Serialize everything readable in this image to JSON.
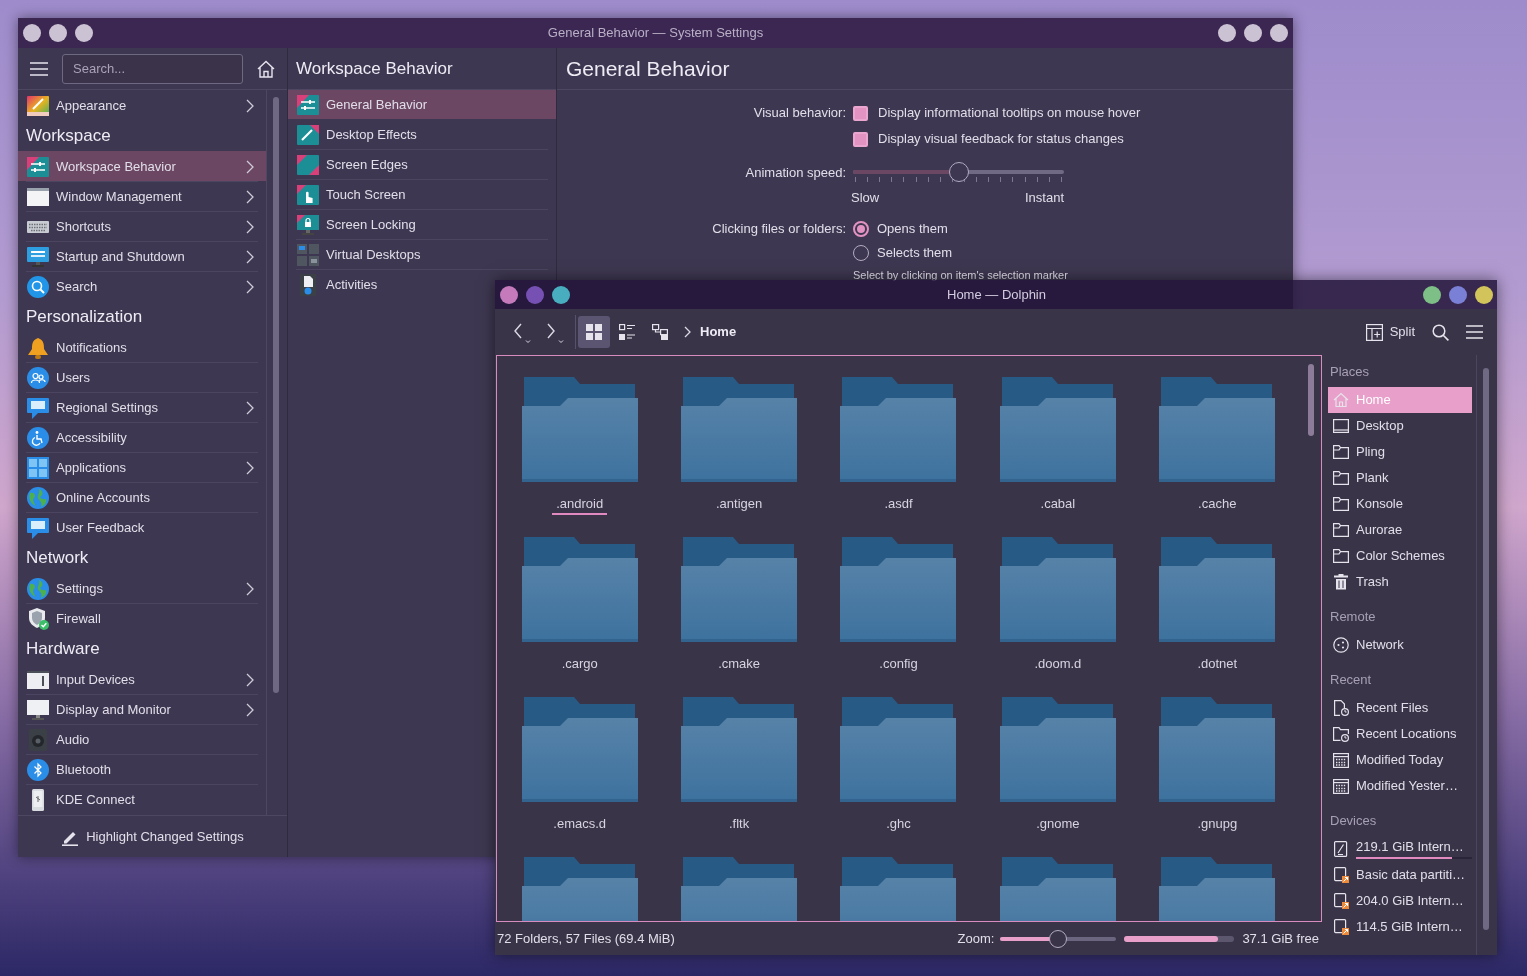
{
  "settings_window": {
    "title": "General Behavior — System Settings",
    "sidebar": {
      "search_placeholder": "Search...",
      "sections": [
        {
          "items": [
            {
              "label": "Appearance",
              "submenu": true,
              "selected": false
            }
          ]
        },
        {
          "title": "Workspace",
          "items": [
            {
              "label": "Workspace Behavior",
              "submenu": true,
              "selected": true
            },
            {
              "label": "Window Management",
              "submenu": true,
              "selected": false
            },
            {
              "label": "Shortcuts",
              "submenu": true,
              "selected": false
            },
            {
              "label": "Startup and Shutdown",
              "submenu": true,
              "selected": false
            },
            {
              "label": "Search",
              "submenu": true,
              "selected": false
            }
          ]
        },
        {
          "title": "Personalization",
          "items": [
            {
              "label": "Notifications",
              "submenu": false,
              "selected": false
            },
            {
              "label": "Users",
              "submenu": false,
              "selected": false
            },
            {
              "label": "Regional Settings",
              "submenu": true,
              "selected": false
            },
            {
              "label": "Accessibility",
              "submenu": false,
              "selected": false
            },
            {
              "label": "Applications",
              "submenu": true,
              "selected": false
            },
            {
              "label": "Online Accounts",
              "submenu": false,
              "selected": false
            },
            {
              "label": "User Feedback",
              "submenu": false,
              "selected": false
            }
          ]
        },
        {
          "title": "Network",
          "items": [
            {
              "label": "Settings",
              "submenu": true,
              "selected": false
            },
            {
              "label": "Firewall",
              "submenu": false,
              "selected": false
            }
          ]
        },
        {
          "title": "Hardware",
          "items": [
            {
              "label": "Input Devices",
              "submenu": true,
              "selected": false
            },
            {
              "label": "Display and Monitor",
              "submenu": true,
              "selected": false
            },
            {
              "label": "Audio",
              "submenu": false,
              "selected": false
            },
            {
              "label": "Bluetooth",
              "submenu": false,
              "selected": false
            },
            {
              "label": "KDE Connect",
              "submenu": false,
              "selected": false
            }
          ]
        }
      ],
      "footer_button": "Highlight Changed Settings"
    },
    "subcategories": {
      "title": "Workspace Behavior",
      "items": [
        {
          "label": "General Behavior",
          "selected": true
        },
        {
          "label": "Desktop Effects",
          "selected": false
        },
        {
          "label": "Screen Edges",
          "selected": false
        },
        {
          "label": "Touch Screen",
          "selected": false
        },
        {
          "label": "Screen Locking",
          "selected": false
        },
        {
          "label": "Virtual Desktops",
          "selected": false
        },
        {
          "label": "Activities",
          "selected": false
        }
      ]
    },
    "page": {
      "title": "General Behavior",
      "rows": [
        {
          "kind": "checkboxes",
          "label": "Visual behavior:",
          "options": [
            {
              "text": "Display informational tooltips on mouse hover",
              "checked": true
            },
            {
              "text": "Display visual feedback for status changes",
              "checked": true
            }
          ]
        },
        {
          "kind": "slider",
          "label": "Animation speed:",
          "level": 0.5,
          "min_label": "Slow",
          "max_label": "Instant"
        },
        {
          "kind": "radios",
          "label": "Clicking files or folders:",
          "options": [
            {
              "text": "Opens them",
              "selected": true
            },
            {
              "text": "Selects them",
              "selected": false
            }
          ],
          "hint": "Select by clicking on item's selection marker"
        }
      ]
    }
  },
  "dolphin_window": {
    "title": "Home — Dolphin",
    "toolbar": {
      "view_modes": [
        {
          "selected": true
        },
        {
          "selected": false
        },
        {
          "selected": false
        }
      ],
      "path": [
        "Home"
      ],
      "split_label": "Split"
    },
    "folders": [
      {
        "name": ".android",
        "current": true
      },
      {
        "name": ".antigen",
        "current": false
      },
      {
        "name": ".asdf",
        "current": false
      },
      {
        "name": ".cabal",
        "current": false
      },
      {
        "name": ".cache",
        "current": false
      },
      {
        "name": ".cargo",
        "current": false
      },
      {
        "name": ".cmake",
        "current": false
      },
      {
        "name": ".config",
        "current": false
      },
      {
        "name": ".doom.d",
        "current": false
      },
      {
        "name": ".dotnet",
        "current": false
      },
      {
        "name": ".emacs.d",
        "current": false
      },
      {
        "name": ".fltk",
        "current": false
      },
      {
        "name": ".ghc",
        "current": false
      },
      {
        "name": ".gnome",
        "current": false
      },
      {
        "name": ".gnupg",
        "current": false
      },
      {
        "current": false
      },
      {
        "current": false
      },
      {
        "current": false
      },
      {
        "current": false
      },
      {
        "current": false
      }
    ],
    "places": {
      "sections": [
        {
          "title": "Places",
          "items": [
            {
              "label": "Home",
              "selected": true
            },
            {
              "label": "Desktop",
              "selected": false
            },
            {
              "label": "Pling",
              "selected": false
            },
            {
              "label": "Plank",
              "selected": false
            },
            {
              "label": "Konsole",
              "selected": false
            },
            {
              "label": "Aurorae",
              "selected": false
            },
            {
              "label": "Color Schemes",
              "selected": false
            },
            {
              "label": "Trash",
              "selected": false
            }
          ]
        },
        {
          "title": "Remote",
          "items": [
            {
              "label": "Network",
              "selected": false
            }
          ]
        },
        {
          "title": "Recent",
          "items": [
            {
              "label": "Recent Files",
              "selected": false
            },
            {
              "label": "Recent Locations",
              "selected": false
            },
            {
              "label": "Modified Today",
              "selected": false
            },
            {
              "label": "Modified Yester…",
              "selected": false
            }
          ]
        },
        {
          "title": "Devices",
          "items": [
            {
              "label": "219.1 GiB Intern…",
              "selected": false,
              "mounted": true,
              "level": 0.83
            },
            {
              "label": "Basic data partiti…",
              "selected": false,
              "mounted": false
            },
            {
              "label": "204.0 GiB Intern…",
              "selected": false,
              "mounted": false
            },
            {
              "label": "114.5 GiB Intern…",
              "selected": false,
              "mounted": false
            }
          ]
        }
      ]
    },
    "status_bar": {
      "summary": "72 Folders, 57 Files (69.4 MiB)",
      "zoom_label": "Zoom:",
      "zoom_slider": {
        "level": 0.5
      },
      "space_bar": {
        "level": 0.85
      },
      "free_label": "37.1 GiB free"
    }
  }
}
